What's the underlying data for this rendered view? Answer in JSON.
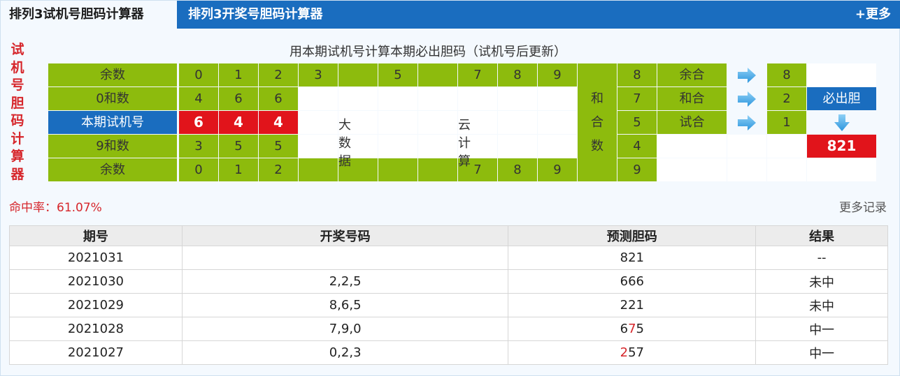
{
  "tabs": {
    "active": "排列3试机号胆码计算器",
    "other": "排列3开奖号胆码计算器",
    "more": "+更多"
  },
  "side_title": [
    "试",
    "机",
    "号",
    "胆",
    "码",
    "计",
    "算",
    "器"
  ],
  "subtitle": "用本期试机号计算本期必出胆码（试机号后更新）",
  "grid": {
    "row1_label": "余数",
    "row1_digits": [
      "0",
      "1",
      "2",
      "3",
      "",
      "5",
      "",
      "7",
      "8",
      "9"
    ],
    "row2_label": "0和数",
    "row2_digits": [
      "4",
      "6",
      "6"
    ],
    "row3_label": "本期试机号",
    "row3_digits": [
      "6",
      "4",
      "4"
    ],
    "row4_label": "9和数",
    "row4_digits": [
      "3",
      "5",
      "5"
    ],
    "row5_label": "余数",
    "row5_digits": [
      "0",
      "1",
      "2",
      "",
      "",
      "",
      "",
      "7",
      "8",
      "9"
    ],
    "big_data": "大数据",
    "cloud": "云计算",
    "sum_col": [
      "和",
      "合",
      "数"
    ],
    "right_nums": [
      "8",
      "7",
      "5",
      "4",
      "9"
    ],
    "labels": [
      "余合",
      "和合",
      "试合"
    ],
    "results": [
      "8",
      "2",
      "1"
    ],
    "must_label": "必出胆",
    "must_value": "821"
  },
  "hit_rate": "命中率：61.07%",
  "more_records": "更多记录",
  "history": {
    "headers": [
      "期号",
      "开奖号码",
      "预测胆码",
      "结果"
    ],
    "rows": [
      {
        "issue": "2021031",
        "draw": "",
        "pred": [
          "8",
          "2",
          "1"
        ],
        "hitmask": [
          false,
          false,
          false
        ],
        "result": "--"
      },
      {
        "issue": "2021030",
        "draw": "2,2,5",
        "pred": [
          "6",
          "6",
          "6"
        ],
        "hitmask": [
          false,
          false,
          false
        ],
        "result": "未中"
      },
      {
        "issue": "2021029",
        "draw": "8,6,5",
        "pred": [
          "2",
          "2",
          "1"
        ],
        "hitmask": [
          false,
          false,
          false
        ],
        "result": "未中"
      },
      {
        "issue": "2021028",
        "draw": "7,9,0",
        "pred": [
          "6",
          "7",
          "5"
        ],
        "hitmask": [
          false,
          true,
          false
        ],
        "result": "中一"
      },
      {
        "issue": "2021027",
        "draw": "0,2,3",
        "pred": [
          "2",
          "5",
          "7"
        ],
        "hitmask": [
          true,
          false,
          false
        ],
        "result": "中一"
      }
    ]
  },
  "colors": {
    "blue": "#1a6dbf",
    "green": "#8dbb0d",
    "red": "#e1141b"
  }
}
